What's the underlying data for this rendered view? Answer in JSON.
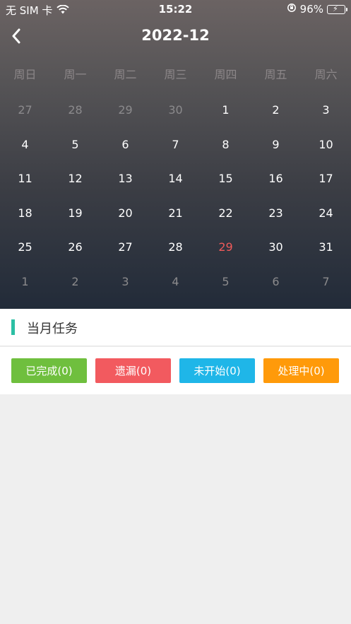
{
  "status_bar": {
    "carrier": "无 SIM 卡",
    "time": "15:22",
    "battery": "96%",
    "battery_level": 0.96
  },
  "nav": {
    "title": "2022-12"
  },
  "weekdays": [
    "周日",
    "周一",
    "周二",
    "周三",
    "周四",
    "周五",
    "周六"
  ],
  "calendar": {
    "weeks": [
      [
        {
          "d": "27",
          "dim": true
        },
        {
          "d": "28",
          "dim": true
        },
        {
          "d": "29",
          "dim": true
        },
        {
          "d": "30",
          "dim": true
        },
        {
          "d": "1"
        },
        {
          "d": "2"
        },
        {
          "d": "3"
        }
      ],
      [
        {
          "d": "4"
        },
        {
          "d": "5"
        },
        {
          "d": "6"
        },
        {
          "d": "7"
        },
        {
          "d": "8"
        },
        {
          "d": "9"
        },
        {
          "d": "10"
        }
      ],
      [
        {
          "d": "11"
        },
        {
          "d": "12"
        },
        {
          "d": "13"
        },
        {
          "d": "14"
        },
        {
          "d": "15"
        },
        {
          "d": "16"
        },
        {
          "d": "17"
        }
      ],
      [
        {
          "d": "18"
        },
        {
          "d": "19"
        },
        {
          "d": "20"
        },
        {
          "d": "21"
        },
        {
          "d": "22"
        },
        {
          "d": "23"
        },
        {
          "d": "24"
        }
      ],
      [
        {
          "d": "25"
        },
        {
          "d": "26"
        },
        {
          "d": "27"
        },
        {
          "d": "28"
        },
        {
          "d": "29",
          "today": true
        },
        {
          "d": "30"
        },
        {
          "d": "31"
        }
      ],
      [
        {
          "d": "1",
          "dim": true
        },
        {
          "d": "2",
          "dim": true
        },
        {
          "d": "3",
          "dim": true
        },
        {
          "d": "4",
          "dim": true
        },
        {
          "d": "5",
          "dim": true
        },
        {
          "d": "6",
          "dim": true
        },
        {
          "d": "7",
          "dim": true
        }
      ]
    ]
  },
  "section": {
    "title": "当月任务"
  },
  "task_buttons": [
    {
      "label": "已完成(0)",
      "color": "#6fbf3e",
      "name": "completed-button"
    },
    {
      "label": "遗漏(0)",
      "color": "#f25a5f",
      "name": "missed-button"
    },
    {
      "label": "未开始(0)",
      "color": "#1fb6e8",
      "name": "not-started-button"
    },
    {
      "label": "处理中(0)",
      "color": "#ff9a0a",
      "name": "in-progress-button"
    }
  ],
  "colors": {
    "accent": "#2bbfa4",
    "today": "#f05a5a"
  }
}
